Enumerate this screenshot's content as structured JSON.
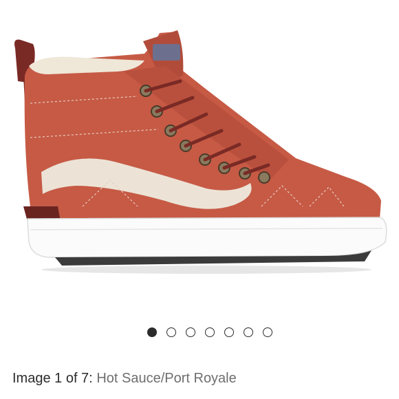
{
  "gallery": {
    "image_icon": "shoe-product-image",
    "total_images": 7,
    "active_index": 1,
    "dots": [
      {
        "active": true
      },
      {
        "active": false
      },
      {
        "active": false
      },
      {
        "active": false
      },
      {
        "active": false
      },
      {
        "active": false
      },
      {
        "active": false
      }
    ]
  },
  "caption": {
    "counter_text": "Image 1 of 7:",
    "color_name": "Hot Sauce/Port Royale"
  },
  "colors": {
    "shoe_main": "#c65a45",
    "shoe_dark": "#7a2a25",
    "stripe": "#ece3d6",
    "sole": "#fbfbfb",
    "dot": "#2b2b2b"
  }
}
